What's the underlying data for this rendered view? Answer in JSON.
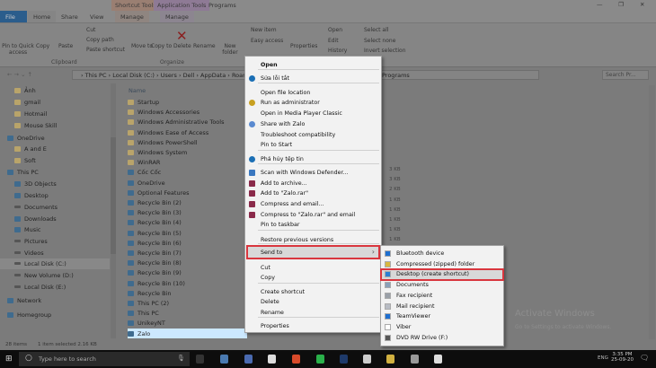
{
  "titlebar": {
    "contextual_tabs": [
      "Shortcut Tools",
      "Application Tools"
    ],
    "title": "Programs",
    "controls": [
      "minimize",
      "restore",
      "close"
    ]
  },
  "tabs": [
    "File",
    "Home",
    "Share",
    "View",
    "Manage",
    "Manage"
  ],
  "ribbon": {
    "clipboard": {
      "pin": "Pin to Quick access",
      "copy": "Copy",
      "paste": "Paste",
      "cut": "Cut",
      "copy_path": "Copy path",
      "paste_shortcut": "Paste shortcut",
      "label": "Clipboard"
    },
    "organize": {
      "move_to": "Move to",
      "copy_to": "Copy to",
      "delete": "Delete",
      "rename": "Rename",
      "label": "Organize"
    },
    "new": {
      "new_folder": "New folder",
      "new_item": "New item",
      "easy_access": "Easy access"
    },
    "open": {
      "properties": "Properties",
      "open": "Open",
      "edit": "Edit",
      "history": "History"
    },
    "select": {
      "select_all": "Select all",
      "select_none": "Select none",
      "invert": "Invert selection"
    }
  },
  "address": {
    "crumbs": [
      "This PC",
      "Local Disk (C:)",
      "Users",
      "Dell",
      "AppData",
      "Roaming",
      "…",
      "Programs"
    ],
    "search_placeholder": "Search Pr..."
  },
  "nav": [
    "Ảnh",
    "gmail",
    "Hotmail",
    "Mouse Skill",
    "OneDrive",
    "A and E",
    "Soft",
    "This PC",
    "3D Objects",
    "Desktop",
    "Documents",
    "Downloads",
    "Music",
    "Pictures",
    "Videos",
    "Local Disk (C:)",
    "New Volume (D:)",
    "Local Disk (E:)",
    "Network",
    "Homegroup"
  ],
  "files": {
    "header": "Name",
    "rows": [
      "Startup",
      "Windows Accessories",
      "Windows Administrative Tools",
      "Windows Ease of Access",
      "Windows PowerShell",
      "Windows System",
      "WinRAR",
      "Cốc Cốc",
      "OneDrive",
      "Optional Features",
      "Recycle Bin (2)",
      "Recycle Bin (3)",
      "Recycle Bin (4)",
      "Recycle Bin (5)",
      "Recycle Bin (6)",
      "Recycle Bin (7)",
      "Recycle Bin (8)",
      "Recycle Bin (9)",
      "Recycle Bin (10)",
      "Recycle Bin",
      "This PC (2)",
      "This PC",
      "UnikeyNT",
      "Zalo"
    ],
    "sizes": [
      "3 KB",
      "3 KB",
      "2 KB",
      "1 KB",
      "1 KB",
      "1 KB",
      "1 KB",
      "1 KB"
    ]
  },
  "context_menu": [
    "Open",
    "Sửa lỗi tắt",
    "Open file location",
    "Run as administrator",
    "Open in Media Player Classic",
    "Share with Zalo",
    "Troubleshoot compatibility",
    "Pin to Start",
    "Phá hủy tệp tin",
    "Scan with Windows Defender...",
    "Add to archive...",
    "Add to \"Zalo.rar\"",
    "Compress and email...",
    "Compress to \"Zalo.rar\" and email",
    "Pin to taskbar",
    "Restore previous versions",
    "Send to",
    "Cut",
    "Copy",
    "Create shortcut",
    "Delete",
    "Rename",
    "Properties"
  ],
  "send_to": [
    "Bluetooth device",
    "Compressed (zipped) folder",
    "Desktop (create shortcut)",
    "Documents",
    "Fax recipient",
    "Mail recipient",
    "TeamViewer",
    "Viber",
    "DVD RW Drive (F:)"
  ],
  "status": {
    "count": "28 items",
    "selected": "1 item selected  2.16 KB"
  },
  "watermark": {
    "title": "Activate Windows",
    "subtitle": "Go to Settings to activate Windows."
  },
  "taskbar": {
    "search_placeholder": "Type here to search",
    "lang": "ENG",
    "time": "3:35 PM",
    "date": "25-09-20"
  },
  "colors": {
    "highlight_border": "#d9363e",
    "file_tab": "#2b5d8c",
    "selection": "#cce8ff"
  }
}
